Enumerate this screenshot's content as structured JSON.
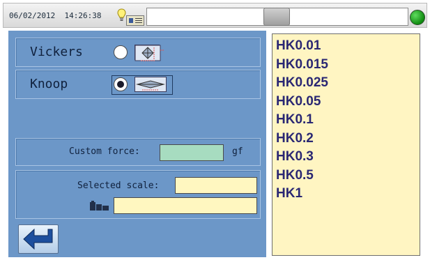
{
  "status_bar": {
    "date": "06/02/2012",
    "time": "14:26:38",
    "status_field_text": "",
    "indicator_color": "#17a117"
  },
  "methods": [
    {
      "label": "Vickers",
      "selected": false,
      "indenter_icon": "pyramid-indenter-icon"
    },
    {
      "label": "Knoop",
      "selected": true,
      "indenter_icon": "elongated-diamond-indenter-icon"
    }
  ],
  "custom_force": {
    "label": "Custom force:",
    "value": "",
    "unit": "gf"
  },
  "selected_scale": {
    "label": "Selected scale:",
    "value": "",
    "secondary_value": "",
    "secondary_icon": "block-weights-icon"
  },
  "back_button": {
    "icon": "return-arrow-icon"
  },
  "scales": [
    "HK0.01",
    "HK0.015",
    "HK0.025",
    "HK0.05",
    "HK0.1",
    "HK0.2",
    "HK0.3",
    "HK0.5",
    "HK1"
  ],
  "colors": {
    "panel": "#6c97c8",
    "list_background": "#fff5c2",
    "list_text": "#2a2773",
    "input_background": "#fff7c0",
    "custom_force_input": "#a7dcc0"
  }
}
